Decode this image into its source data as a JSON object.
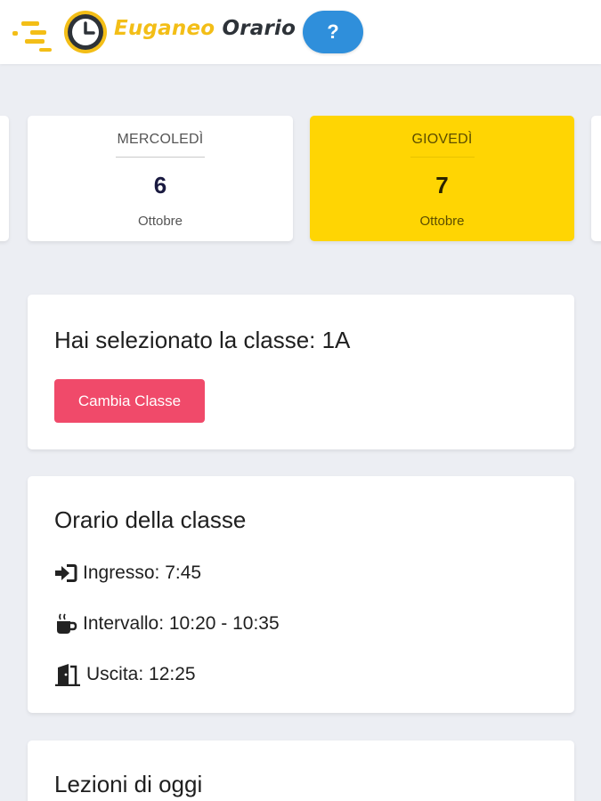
{
  "header": {
    "brand_part1": "Euganeo",
    "brand_part2": "Orario",
    "help_label": "?"
  },
  "days": [
    {
      "name": "MERCOLEDÌ",
      "number": "6",
      "month": "Ottobre",
      "active": false
    },
    {
      "name": "GIOVEDÌ",
      "number": "7",
      "month": "Ottobre",
      "active": true
    }
  ],
  "class_panel": {
    "title": "Hai selezionato la classe: 1A",
    "change_button": "Cambia Classe"
  },
  "schedule_panel": {
    "title": "Orario della classe",
    "entrance": "Ingresso: 7:45",
    "interval": "Intervallo: 10:20 - 10:35",
    "exit": "Uscita: 12:25"
  },
  "lessons_panel": {
    "title": "Lezioni di oggi"
  },
  "colors": {
    "brand_yellow": "#f3be17",
    "active_day": "#ffd503",
    "help_blue": "#2f8fdb",
    "change_button": "#f04a6a"
  },
  "icons": {
    "logo": "clock-icon",
    "entrance": "sign-in-icon",
    "interval": "coffee-icon",
    "exit": "door-open-icon"
  }
}
